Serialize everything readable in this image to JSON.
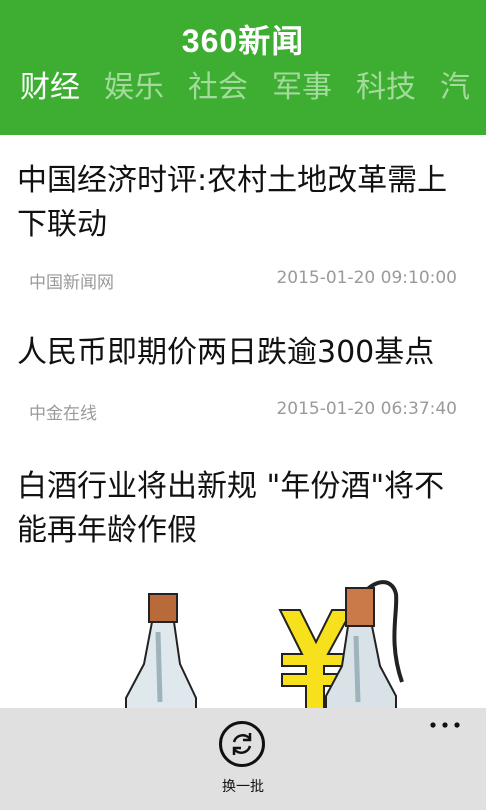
{
  "header": {
    "logo": "360新闻",
    "tabs": [
      "财经",
      "娱乐",
      "社会",
      "军事",
      "科技",
      "汽"
    ]
  },
  "articles": [
    {
      "title": "中国经济时评:农村土地改革需上下联动",
      "source": "中国新闻网",
      "time": "2015-01-20 09:10:00"
    },
    {
      "title": "人民币即期价两日跌逾300基点",
      "source": "中金在线",
      "time": "2015-01-20 06:37:40"
    },
    {
      "title": "白酒行业将出新规 \"年份酒\"将不能再年龄作假"
    }
  ],
  "appbar": {
    "refresh_label": "换一批"
  },
  "colors": {
    "brand_green": "#3dae32",
    "inactive_tab": "#a4da9c",
    "appbar_bg": "#e0e0e0"
  }
}
